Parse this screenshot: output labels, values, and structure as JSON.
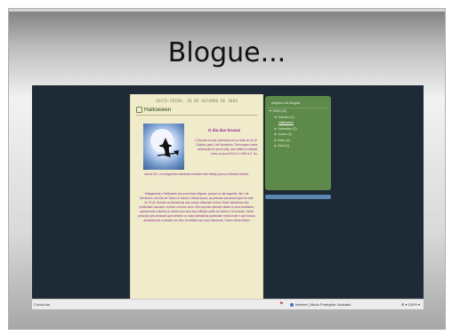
{
  "slide": {
    "title": "Blogue..."
  },
  "post": {
    "date": "SEXTA-FEIRA, 30 DE OUTUBRO DE 2009",
    "title": "Halloween",
    "heading": "O dia das bruxas",
    "side_text": "O dia das bruxas comemora-se na noite de 31 de Outubro para 1 de Novembro. Tem origem numa celebração do povo celta, que habitou a Irlanda entre os anos 600 a.C e 800 d.C. No",
    "full_line": "século XIX, os emigrantes Irlandeses levaram este festejo para os Estados Unidos.",
    "paragraph": "Antigamente o Halloween era uma festa religiosa, porque no dia seguinte, dia 1 de Novembro, era Dia de Todos os Santos. Nessa época, as pessoas pensavam que na noite de 31 de Outubro os fantasmas dos mortos visitavam a terra. Estes fantasmas são pretendiam assustar ou fazer mal aos vivos. Eles apenas queriam visitar os seus familiares, aparecendo a lareira ou sentar com uma boa refeição antes do inverno. No entanto, havia pessoas que achavam que também os maus fantasmas apareciam nessa noite e que bruxas assustadoras cruzavam os céus montadas nas suas vassouras. Outros ainda diziam"
  },
  "archive": {
    "title": "Arquivo do blogue",
    "year": "▼ 2009 (20)",
    "month_open": "▼ Outubro (1)",
    "post_link": "Halloween",
    "months": [
      "► Setembro (2)",
      "► Junho (3)",
      "► Maio (9)",
      "► Abril (4)"
    ]
  },
  "statusbar": {
    "left": "Concluído",
    "zone": "Internet | Modo Protegido: Activado",
    "zoom": "⊕ ▾  ⁠100% ▾"
  }
}
